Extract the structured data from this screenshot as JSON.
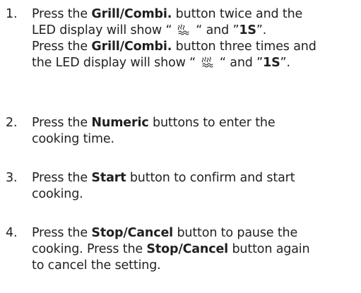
{
  "steps": [
    {
      "number": "1.",
      "line1": {
        "t1": "Press the ",
        "b1": "Grill/Combi.",
        "t2": " button twice and the"
      },
      "line2": {
        "t1": "LED display will show “ ",
        "t2": " “ and ”",
        "b1": "1S",
        "t3": "”."
      },
      "line3": {
        "t1": "Press the ",
        "b1": "Grill/Combi.",
        "t2": " button three times and"
      },
      "line4": {
        "t1": "the LED display will show “ ",
        "t2": " “ and ”",
        "b1": "1S",
        "t3": "”."
      }
    },
    {
      "number": "2.",
      "line1": {
        "t1": "Press the ",
        "b1": "Numeric",
        "t2": " buttons to enter the"
      },
      "line2": {
        "t1": "cooking time."
      }
    },
    {
      "number": "3.",
      "line1": {
        "t1": "Press the ",
        "b1": "Start",
        "t2": " button to confirm and start"
      },
      "line2": {
        "t1": "cooking."
      }
    },
    {
      "number": "4.",
      "line1": {
        "t1": "Press the ",
        "b1": "Stop/Cancel",
        "t2": " button to pause the"
      },
      "line2": {
        "t1": "cooking. Press the ",
        "b1": "Stop/Cancel",
        "t2": " button again"
      },
      "line3": {
        "t1": "to cancel the setting."
      }
    }
  ],
  "icons": {
    "combi_1": "grill-microwave-combi-icon",
    "combi_2": "grill-microwave-combi-icon-double"
  },
  "colors": {
    "text": "#231f20"
  }
}
